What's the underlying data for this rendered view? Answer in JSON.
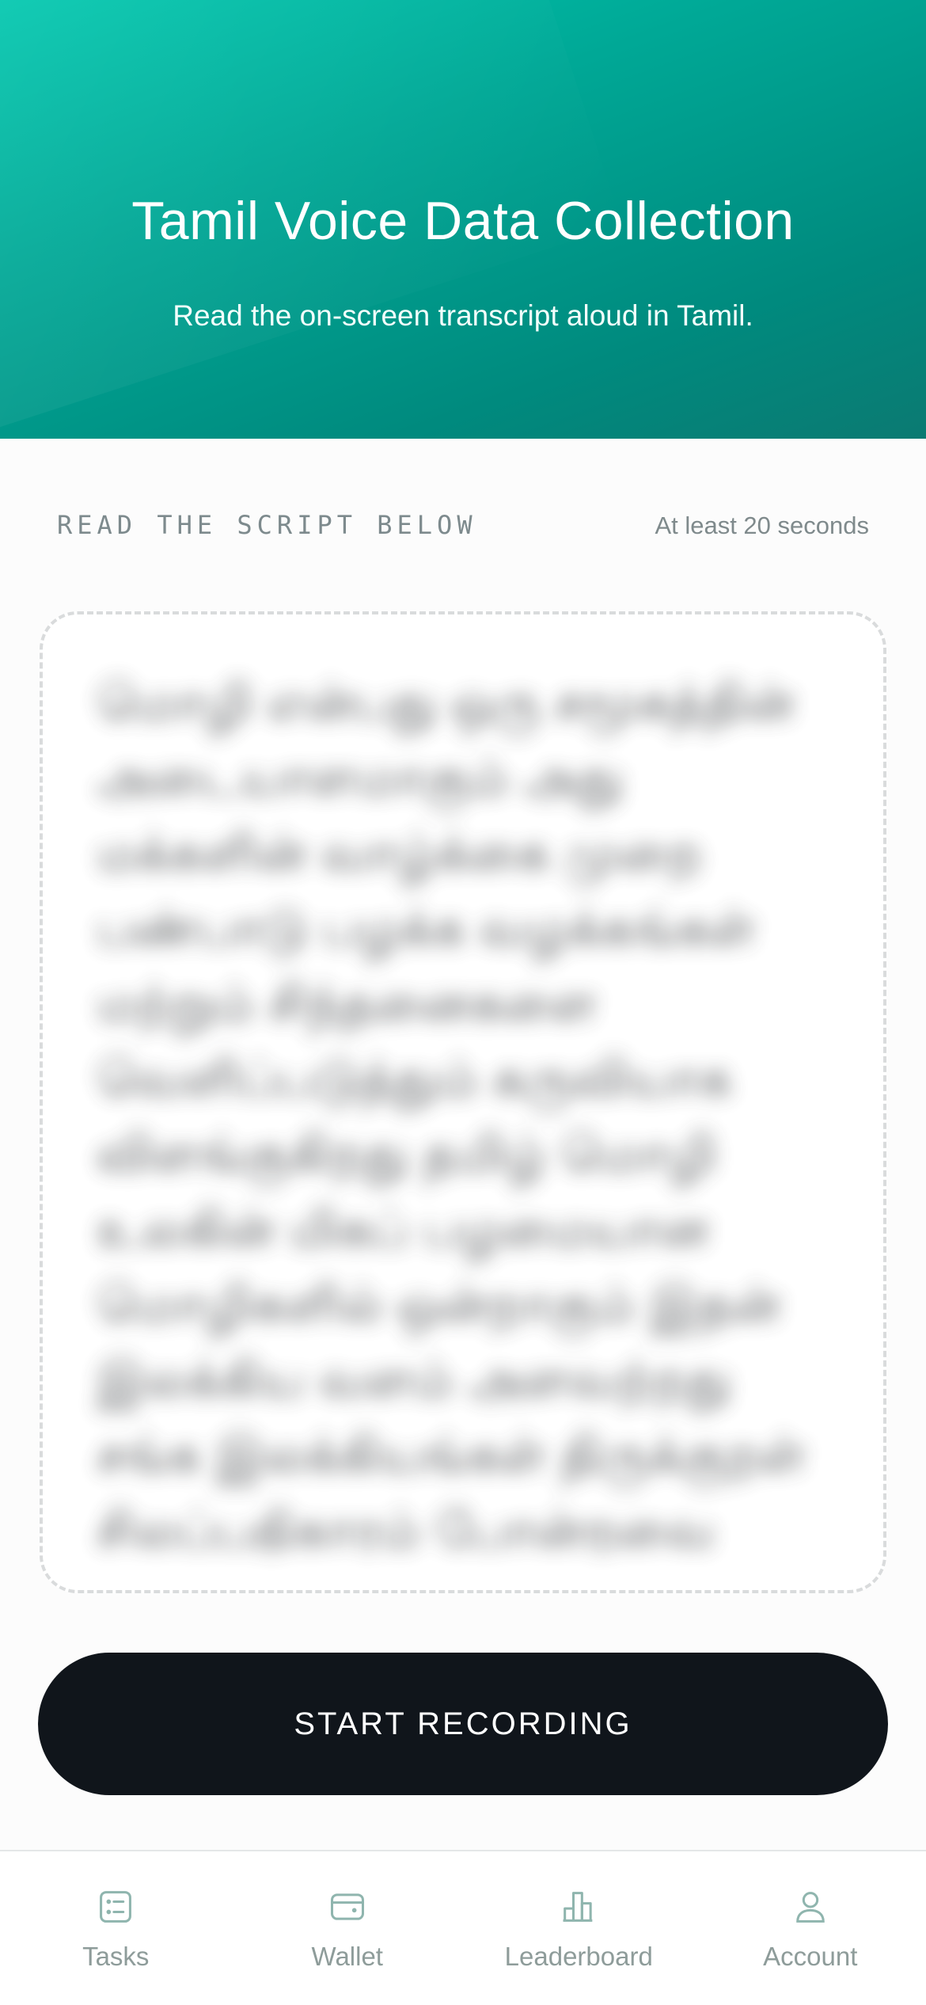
{
  "header": {
    "title": "Tamil Voice Data Collection",
    "subtitle": "Read the on-screen transcript aloud in Tamil."
  },
  "script": {
    "label": "READ THE SCRIPT BELOW",
    "duration": "At least 20 seconds",
    "text": "மொழி என்பது ஒரு சமூகத்தின் அடையாளமாகும் அது மக்களின் வாழ்க்கை முறை பண்பாடு பழக்க வழக்கங்கள் மற்றும் சிந்தனைகளை வெளிப்படுத்தும் கருவியாக விளங்குகிறது தமிழ் மொழி உலகின் மிகப் பழமையான மொழிகளில் ஒன்றாகும் இதன் இலக்கிய வளம் அளவற்றது சங்க இலக்கியங்கள் திருக்குறள் சிலப்பதிகாரம் போன்றவை இன்றும் உலகம் முழுவதும் போற்றப்படுகின்றன"
  },
  "record_button": {
    "label": "START RECORDING"
  },
  "tabbar": {
    "tabs": [
      {
        "label": "Tasks",
        "icon": "list-icon"
      },
      {
        "label": "Wallet",
        "icon": "wallet-icon"
      },
      {
        "label": "Leaderboard",
        "icon": "bar-chart-icon"
      },
      {
        "label": "Account",
        "icon": "user-icon"
      }
    ],
    "icon_color": "#8fb5ae"
  },
  "colors": {
    "header_gradient_start": "#00c7ae",
    "header_gradient_end": "#0b7a72",
    "button_background": "#10151b"
  }
}
